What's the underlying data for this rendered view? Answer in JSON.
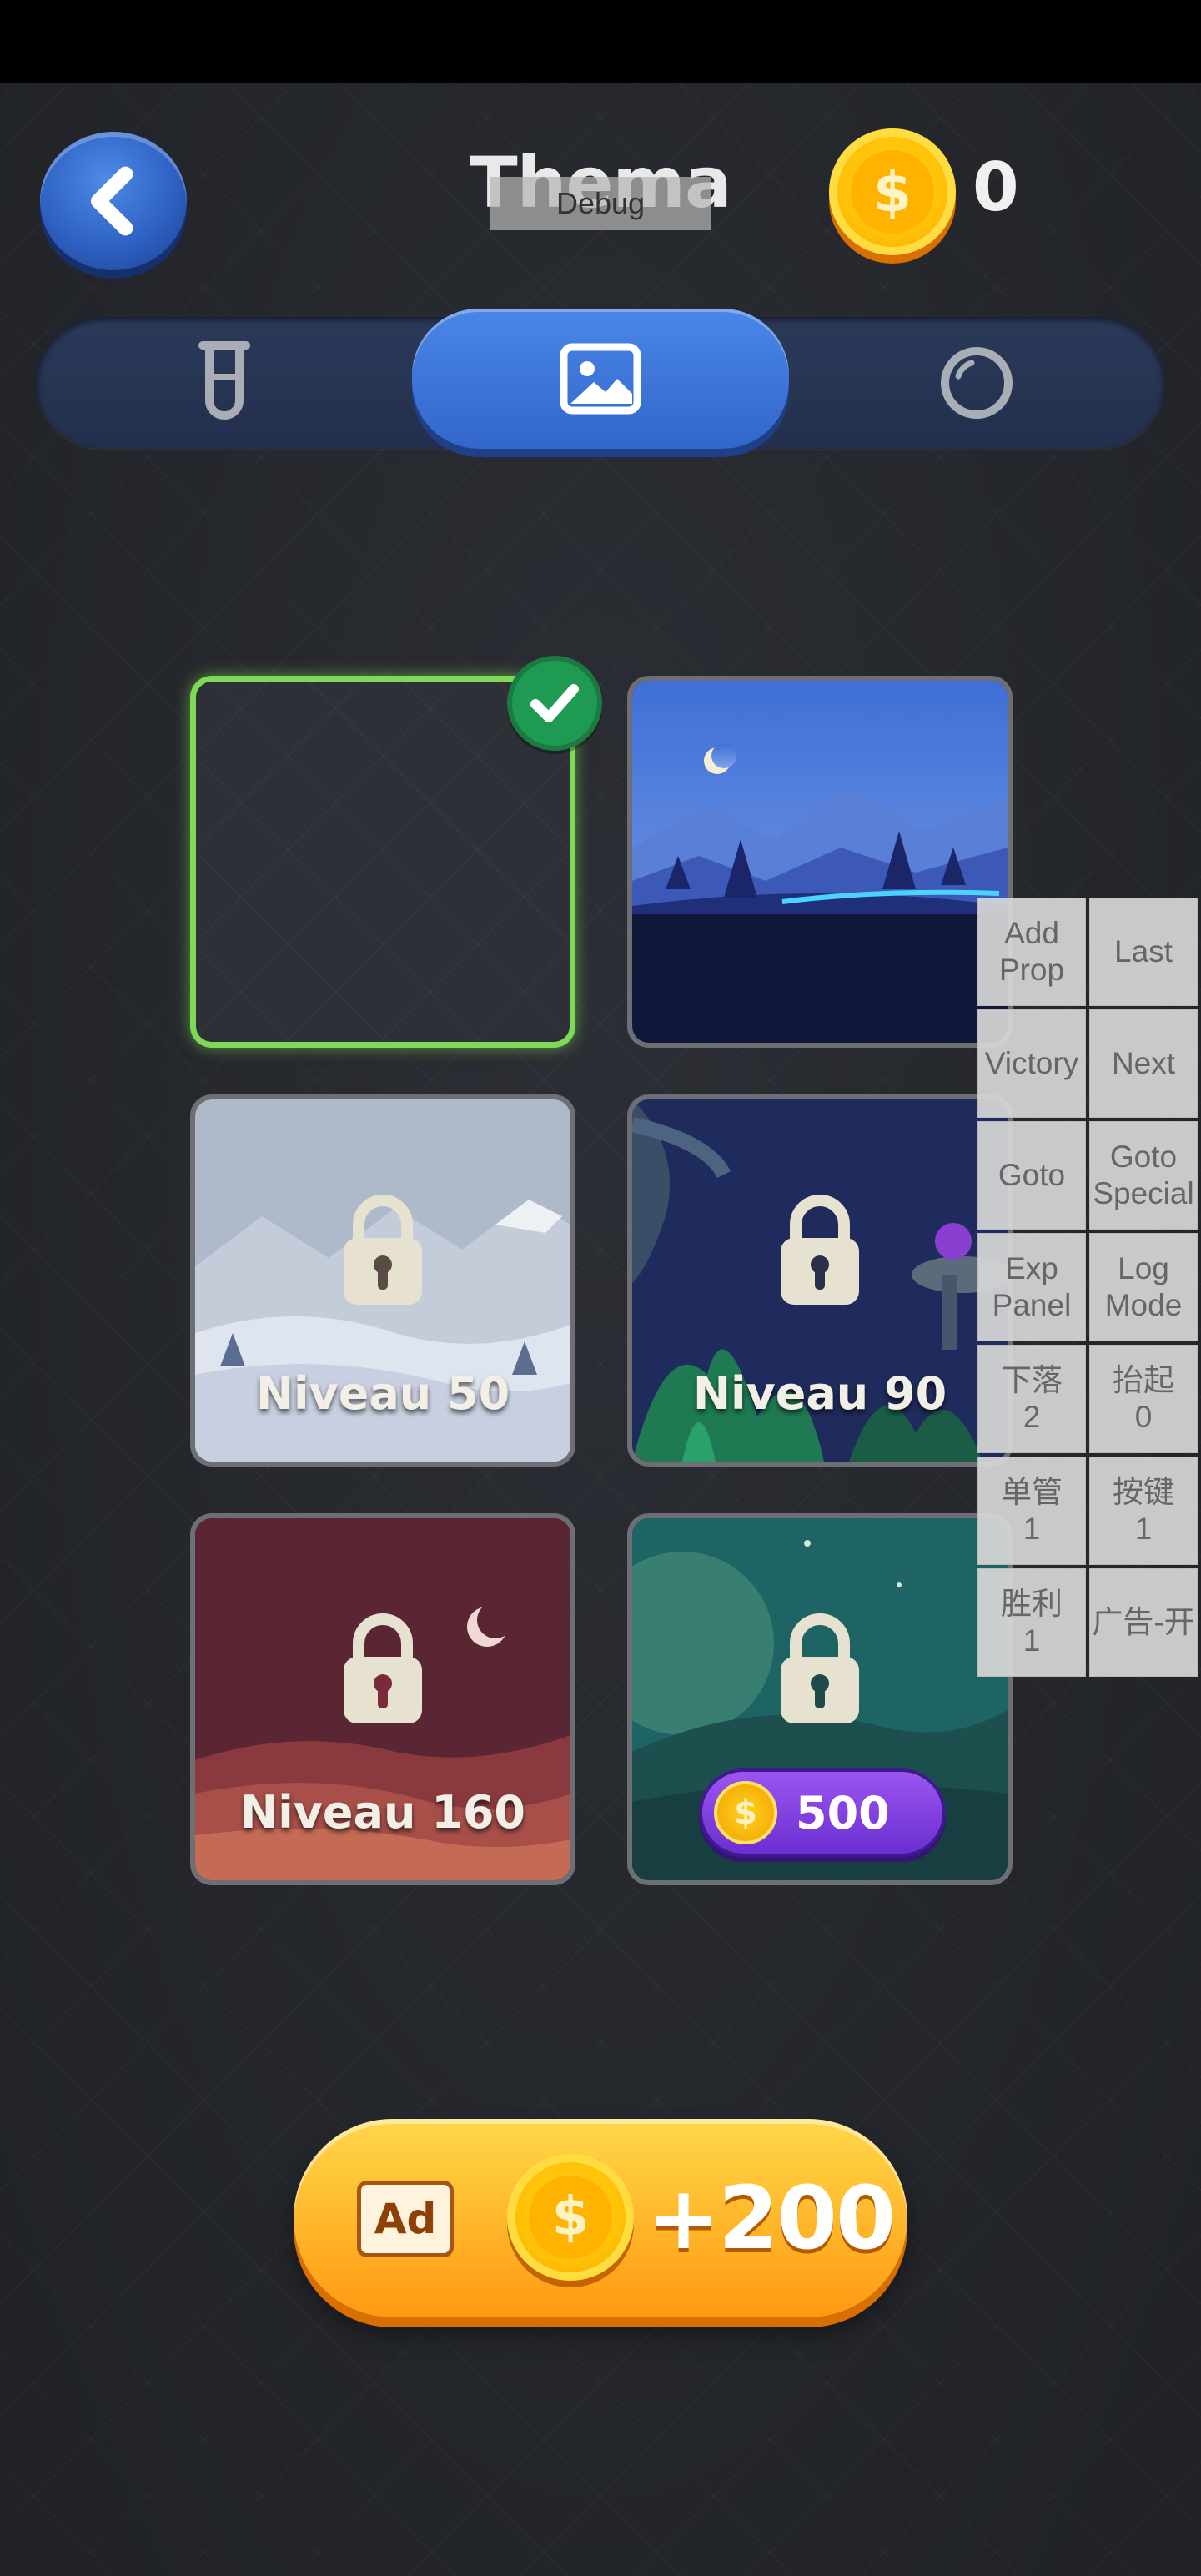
{
  "header": {
    "title": "Thema",
    "debug_label": "Debug",
    "coin_symbol": "$",
    "coin_count": "0"
  },
  "tabs": [
    {
      "id": "tubes",
      "icon": "test-tube-icon",
      "active": false
    },
    {
      "id": "theme",
      "icon": "image-icon",
      "active": true
    },
    {
      "id": "ball",
      "icon": "ball-icon",
      "active": false
    }
  ],
  "themes": [
    {
      "id": "default",
      "selected": true,
      "locked": false,
      "label": ""
    },
    {
      "id": "night-mountains",
      "selected": false,
      "locked": false,
      "label": ""
    },
    {
      "id": "snow",
      "selected": false,
      "locked": true,
      "label": "Niveau 50"
    },
    {
      "id": "jungle",
      "selected": false,
      "locked": true,
      "label": "Niveau 90"
    },
    {
      "id": "desert",
      "selected": false,
      "locked": true,
      "label": "Niveau 160"
    },
    {
      "id": "moon",
      "selected": false,
      "locked": true,
      "price_symbol": "$",
      "price": "500"
    }
  ],
  "debug_panel": {
    "buttons": [
      "Add\nProp",
      "Last",
      "Victory",
      "Next",
      "Goto",
      "Goto\nSpecial",
      "Exp\nPanel",
      "Log\nMode",
      "下落\n2",
      "抬起\n0",
      "单管\n1",
      "按键\n1",
      "胜利\n1",
      "广告-开"
    ]
  },
  "ad_button": {
    "tag": "Ad",
    "coin_symbol": "$",
    "amount": "+200"
  },
  "colors": {
    "background": "#232529",
    "accent_blue": "#3d74d8",
    "selected_green": "#7ed957",
    "coin_gold": "#ffc107",
    "price_purple": "#7b3fe0"
  }
}
